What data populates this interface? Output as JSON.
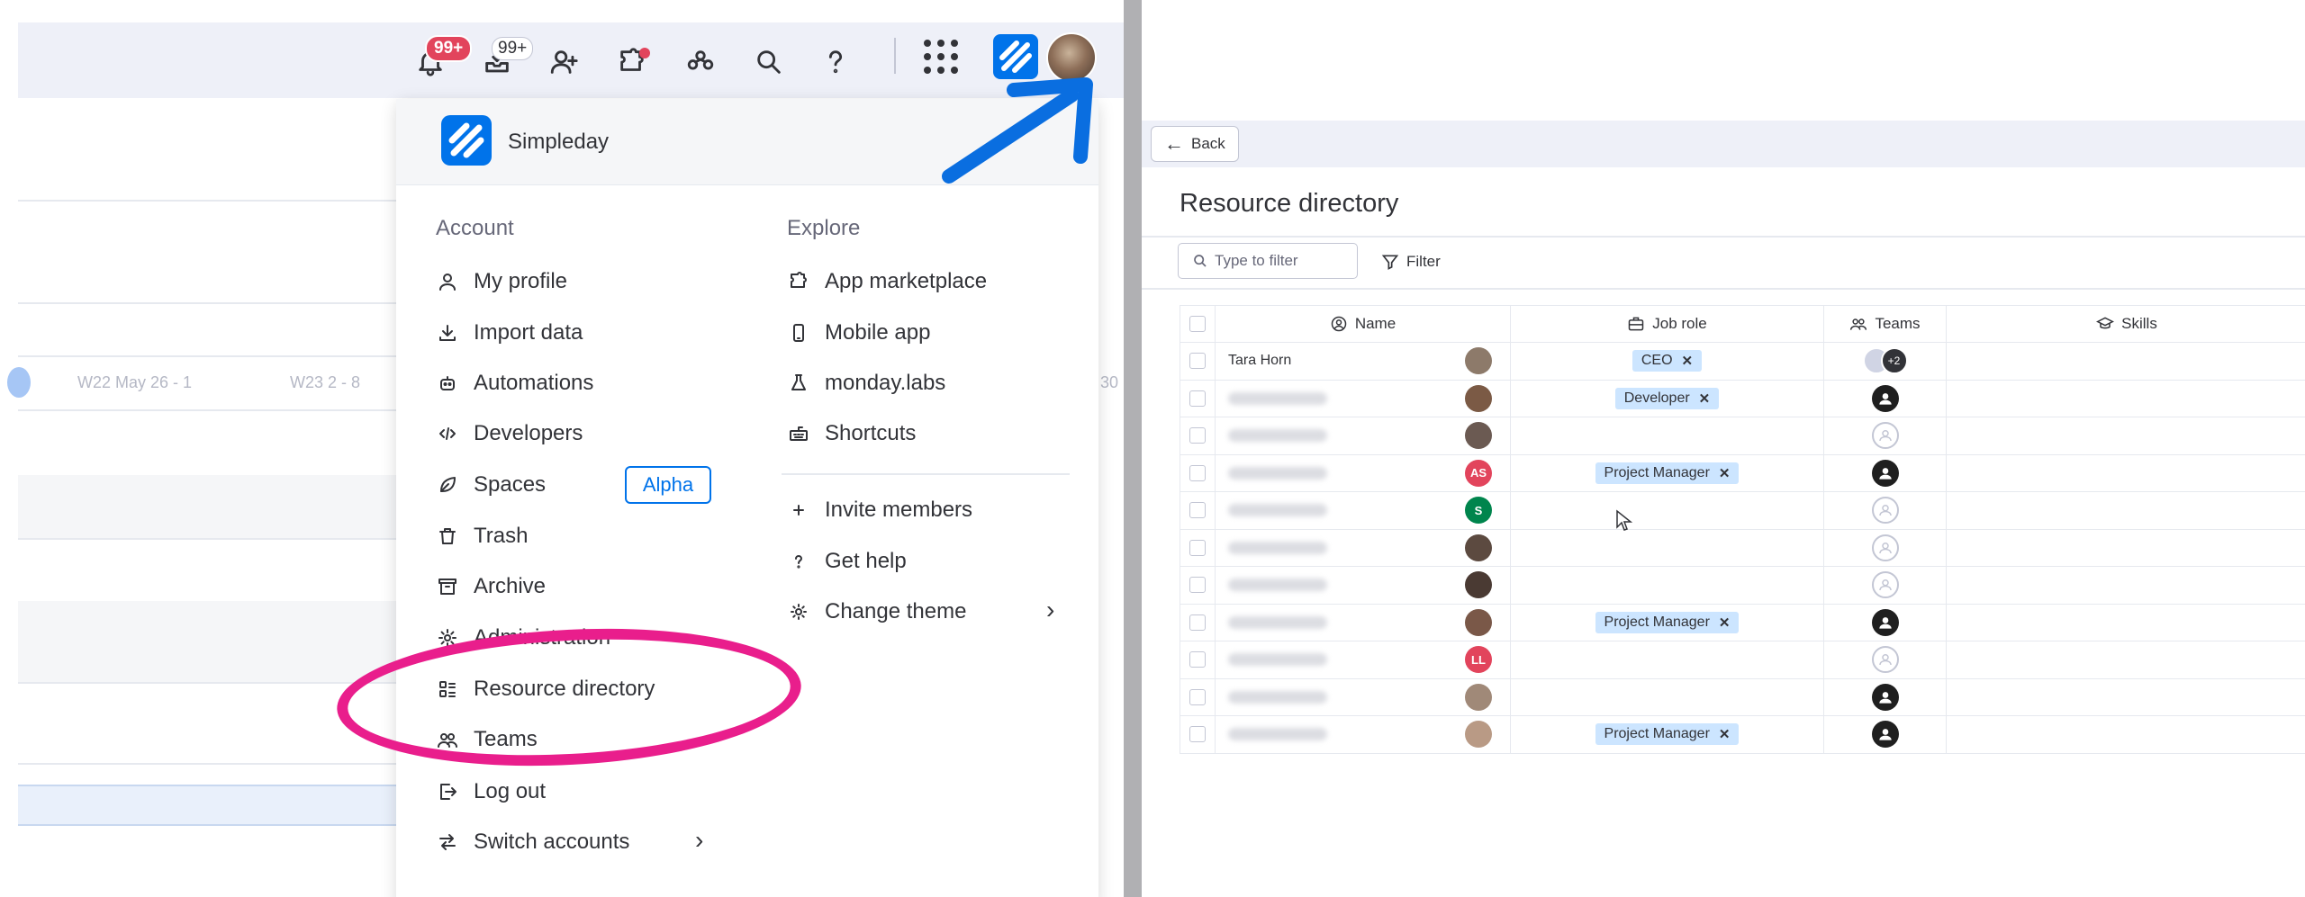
{
  "left_panel": {
    "topbar": {
      "notifications_badge": "99+",
      "inbox_badge": "99+"
    },
    "timeline": {
      "week_1": "W22 May 26 - 1",
      "week_2": "W23 2 - 8",
      "week_3": "30"
    },
    "menu": {
      "brand_name": "Simpleday",
      "account_title": "Account",
      "explore_title": "Explore",
      "account_items": [
        {
          "label": "My profile",
          "icon": "person-icon"
        },
        {
          "label": "Import data",
          "icon": "download-icon"
        },
        {
          "label": "Automations",
          "icon": "robot-icon"
        },
        {
          "label": "Developers",
          "icon": "code-icon"
        },
        {
          "label": "Spaces",
          "icon": "leaf-icon"
        },
        {
          "label": "Trash",
          "icon": "trash-icon"
        },
        {
          "label": "Archive",
          "icon": "archive-icon"
        },
        {
          "label": "Administration",
          "icon": "gear-icon"
        },
        {
          "label": "Resource directory",
          "icon": "directory-icon"
        },
        {
          "label": "Teams",
          "icon": "teams-icon"
        },
        {
          "label": "Log out",
          "icon": "logout-icon"
        },
        {
          "label": "Switch accounts",
          "icon": "switch-icon"
        }
      ],
      "spaces_badge": "Alpha",
      "explore_items": [
        {
          "label": "App marketplace",
          "icon": "puzzle-icon"
        },
        {
          "label": "Mobile app",
          "icon": "mobile-icon"
        },
        {
          "label": "monday.labs",
          "icon": "flask-icon"
        },
        {
          "label": "Shortcuts",
          "icon": "keyboard-icon"
        }
      ],
      "explore_items_2": [
        {
          "label": "Invite members",
          "icon": "plus-icon"
        },
        {
          "label": "Get help",
          "icon": "question-icon"
        },
        {
          "label": "Change theme",
          "icon": "sun-icon"
        }
      ]
    }
  },
  "right_panel": {
    "back_label": "Back",
    "title": "Resource directory",
    "filter_placeholder": "Type to filter",
    "filter_label": "Filter",
    "columns": [
      "Name",
      "Job role",
      "Teams",
      "Skills"
    ],
    "rows": [
      {
        "name": "Tara Horn",
        "avatar_color": "#8d7a6a",
        "avatar_initials": "",
        "role": "CEO",
        "team": "multi",
        "team_extra": "+2"
      },
      {
        "name": "",
        "avatar_color": "#7b5a45",
        "avatar_initials": "",
        "role": "Developer",
        "team": "dark"
      },
      {
        "name": "",
        "avatar_color": "#6b5a52",
        "avatar_initials": "",
        "role": "",
        "team": "empty"
      },
      {
        "name": "",
        "avatar_color": "#e2445c",
        "avatar_initials": "AS",
        "role": "Project Manager",
        "team": "dark"
      },
      {
        "name": "",
        "avatar_color": "#00854d",
        "avatar_initials": "S",
        "role": "",
        "team": "empty"
      },
      {
        "name": "",
        "avatar_color": "#5c4a40",
        "avatar_initials": "",
        "role": "",
        "team": "empty"
      },
      {
        "name": "",
        "avatar_color": "#4a3a33",
        "avatar_initials": "",
        "role": "",
        "team": "empty"
      },
      {
        "name": "",
        "avatar_color": "#7a5848",
        "avatar_initials": "",
        "role": "Project Manager",
        "team": "dark"
      },
      {
        "name": "",
        "avatar_color": "#e2445c",
        "avatar_initials": "LL",
        "role": "",
        "team": "empty"
      },
      {
        "name": "",
        "avatar_color": "#a08978",
        "avatar_initials": "",
        "role": "",
        "team": "dark"
      },
      {
        "name": "",
        "avatar_color": "#b99a85",
        "avatar_initials": "",
        "role": "Project Manager",
        "team": "dark"
      }
    ]
  },
  "colors": {
    "brand_blue": "#0073ea",
    "annotation_pink": "#e91e8c",
    "annotation_blue": "#0a6ee0",
    "chip_blue": "#cce5ff",
    "badge_red": "#e2445c"
  }
}
